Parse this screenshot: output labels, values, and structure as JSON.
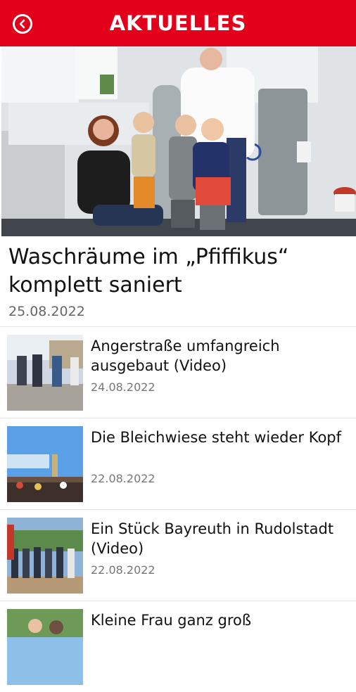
{
  "header": {
    "title": "AKTUELLES",
    "back_icon": "chevron-left-circle-icon"
  },
  "featured": {
    "title": "Waschräume im „Pfiffikus“ komplett saniert",
    "date": "25.08.2022"
  },
  "articles": [
    {
      "title": "Angerstraße umfangreich ausgebaut (Video)",
      "date": "24.08.2022"
    },
    {
      "title": "Die Bleichwiese steht wieder Kopf",
      "date": "22.08.2022"
    },
    {
      "title": "Ein Stück Bayreuth in Rudolstadt (Video)",
      "date": "22.08.2022"
    },
    {
      "title": "Kleine Frau ganz groß",
      "date": ""
    }
  ],
  "colors": {
    "brand": "#e2001a"
  }
}
